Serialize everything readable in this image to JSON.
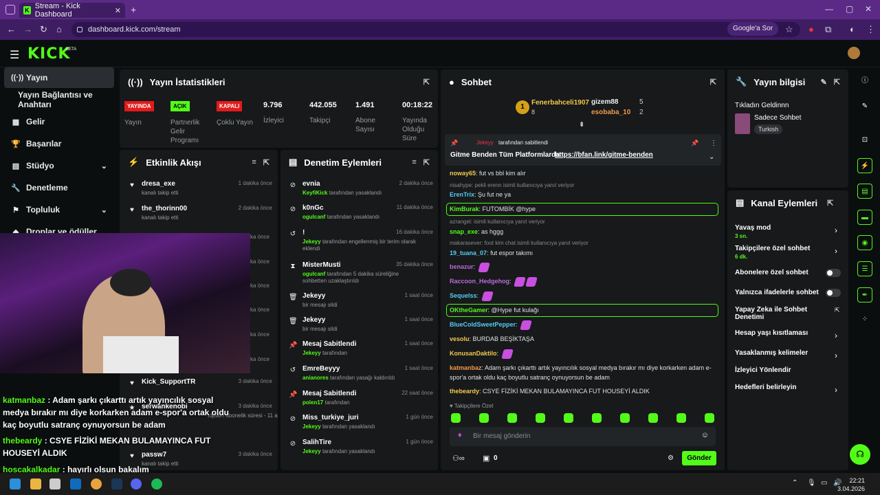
{
  "browser": {
    "tab_title": "Stream - Kick Dashboard",
    "url": "dashboard.kick.com/stream",
    "google_btn": "Google'a Sor"
  },
  "app": {
    "logo": "KICK",
    "beta": "BETA"
  },
  "sidebar": {
    "items": [
      {
        "label": "Yayın",
        "icon": "broadcast-icon"
      },
      {
        "label": "Yayın Bağlantısı ve Anahtarı",
        "icon": ""
      },
      {
        "label": "Gelir",
        "icon": "revenue-icon"
      },
      {
        "label": "Başarılar",
        "icon": "trophy-icon"
      },
      {
        "label": "Stüdyo",
        "icon": "studio-icon"
      },
      {
        "label": "Denetleme",
        "icon": "wrench-icon"
      },
      {
        "label": "Topluluk",
        "icon": "community-icon"
      },
      {
        "label": "Droplar ve ödüller",
        "icon": "drops-icon"
      }
    ]
  },
  "stats": {
    "title": "Yayın İstatistikleri",
    "cells": [
      {
        "badge": "YAYINDA",
        "label": "Yayın"
      },
      {
        "badge": "AÇIK",
        "label": "Partnerlik Gelir Programı"
      },
      {
        "badge": "KAPALI",
        "label": "Çoklu Yayın"
      },
      {
        "value": "9.796",
        "label": "İzleyici"
      },
      {
        "value": "442.055",
        "label": "Takipçi"
      },
      {
        "value": "1.491",
        "label": "Abone Sayısı"
      },
      {
        "value": "00:18:22",
        "label": "Yayında Olduğu Süre"
      }
    ]
  },
  "activity": {
    "title": "Etkinlik Akışı",
    "items": [
      {
        "name": "dresa_exe",
        "sub": "kanalı takip etti",
        "time": "1 dakika önce"
      },
      {
        "name": "the_thorinn00",
        "sub": "kanalı takip etti",
        "time": "2 dakika önce"
      },
      {
        "name": "Kick_SupportTR",
        "sub": "",
        "time": "3 dakika önce"
      },
      {
        "name": "serwankenobi",
        "sub": "toplam abonelik süresi - 11 ay!",
        "time": "3 dakika önce"
      },
      {
        "name": "passw7",
        "sub": "kanalı takip etti",
        "time": "3 dakika önce"
      }
    ],
    "hidden_times": [
      "1 dakika önce",
      "1 dakika önce",
      "1 dakika önce",
      "1 dakika önce",
      "2 dakika önce",
      "2 dakika önce"
    ]
  },
  "moderation": {
    "title": "Denetim Eylemleri",
    "items": [
      {
        "name": "evnia",
        "actor": "KeyfiKick",
        "sub": "tarafından yasaklandı",
        "time": "2 dakika önce",
        "icon": "ban-icon"
      },
      {
        "name": "k0nGc",
        "actor": "ogulcanf",
        "sub": "tarafından yasaklandı",
        "time": "11 dakika önce",
        "icon": "ban-icon"
      },
      {
        "name": "!",
        "actor": "Jekeyy",
        "sub": "tarafından engellenmiş bir terim olarak eklendi",
        "time": "16 dakika önce",
        "icon": "undo-icon"
      },
      {
        "name": "MisterMusti",
        "actor": "ogulcanf",
        "sub": "tarafından 5 dakika süreliğine sohbetten uzaklaştırıldı",
        "time": "35 dakika önce",
        "icon": "hourglass-icon"
      },
      {
        "name": "Jekeyy",
        "actor": "",
        "sub": "bir mesajı sildi",
        "time": "1 saat önce",
        "icon": "trash-icon"
      },
      {
        "name": "Jekeyy",
        "actor": "",
        "sub": "bir mesajı sildi",
        "time": "1 saat önce",
        "icon": "trash-icon"
      },
      {
        "name": "Mesaj Sabitlendi",
        "actor": "Jekeyy",
        "sub": "tarafından",
        "time": "1 saat önce",
        "icon": "pin-icon"
      },
      {
        "name": "EmreBeyyy",
        "actor": "anianores",
        "sub": "tarafından yasağı kaldırıldı",
        "time": "1 saat önce",
        "icon": "undo-icon"
      },
      {
        "name": "Mesaj Sabitlendi",
        "actor": "polen17",
        "sub": "tarafından",
        "time": "22 saat önce",
        "icon": "pin-icon"
      },
      {
        "name": "Miss_turkiye_juri",
        "actor": "Jekeyy",
        "sub": "tarafından yasaklandı",
        "time": "1 gün önce",
        "icon": "ban-icon"
      },
      {
        "name": "SalihTire",
        "actor": "Jekeyy",
        "sub": "tarafından yasaklandı",
        "time": "1 gün önce",
        "icon": "ban-icon"
      }
    ]
  },
  "chat": {
    "title": "Sohbet",
    "leaders": [
      {
        "rank": "1",
        "name": "Fenerbahceli1907",
        "count": "8"
      },
      {
        "name": "gizem88",
        "count": "5"
      },
      {
        "name": "esobaba_10",
        "count": "2"
      }
    ],
    "pinned": {
      "by": "Jekeyy",
      "by_suffix": "tarafından sabitlendi",
      "text": "Gitme Benden Tüm Platformlarda:",
      "link": "https://bfan.link/gitme-benden"
    },
    "messages": [
      {
        "user": "noway65",
        "text": "fut vs bbl kim alır",
        "color": "#f2c94c"
      },
      {
        "reply": "nisahype: pekli erenn isimli kullanıcıya yanıt veriyor"
      },
      {
        "user": "ErenTrix",
        "text": "Şu fut ne ya",
        "color": "#56ccf2"
      },
      {
        "user": "KimBurak",
        "text": "FUTOMBİK @hype",
        "color": "#53fc18",
        "hl": true
      },
      {
        "reply": "azrangel: isimli kullanıcıya yanıt veriyor"
      },
      {
        "user": "snap_exe",
        "text": "as hggg",
        "color": "#53fc18"
      },
      {
        "reply": "makarasever: foot kim chat isimli kullanıcıya yanıt veriyor"
      },
      {
        "user": "19_tuana_07",
        "text": "fut espor takımı",
        "color": "#56ccf2"
      },
      {
        "user": "benazur",
        "text": "",
        "color": "#bb6bd9"
      },
      {
        "user": "Raccoon_Hedgehog",
        "text": "",
        "color": "#bb6bd9"
      },
      {
        "user": "Sequelss",
        "text": "",
        "color": "#56ccf2"
      },
      {
        "user": "OKtheGamer",
        "text": "@Hype fut kulağı",
        "color": "#53fc18",
        "hl": true
      },
      {
        "user": "BlueColdSweetPepper",
        "text": "",
        "color": "#56ccf2"
      },
      {
        "user": "vesolu",
        "text": "BURDAB BEŞİKTAŞA",
        "color": "#f2c94c"
      },
      {
        "user": "KonusanDaktilo",
        "text": "",
        "color": "#f2c94c"
      },
      {
        "user": "katmanbaz",
        "text": "Adam şarkı çıkarttı artık yayıncılık sosyal medya bırakır mı diye korkarken adam e-spor'a ortak oldu kaç boyutlu satranç oynuyorsun be adam",
        "color": "#f2994a"
      },
      {
        "user": "thebeardy",
        "text": "CSYE FİZİKİ MEKAN BULAMAYINCA FUT HOUSEYİ ALDIK",
        "color": "#f2c94c"
      }
    ],
    "followers_only": "Takipçilere Özel",
    "input_placeholder": "Bir mesaj gönderin",
    "count": "0",
    "send": "Gönder"
  },
  "stream_info": {
    "title": "Yayın bilgisi",
    "stream_title": "Tıkladın Geldinnn",
    "category": "Sadece Sohbet",
    "tag": "Turkish"
  },
  "channel_actions": {
    "title": "Kanal Eylemleri",
    "items": [
      {
        "label": "Yavaş mod",
        "sub": "3 sn.",
        "ctrl": "chevron"
      },
      {
        "label": "Takipçilere özel sohbet",
        "sub": "6 dk.",
        "ctrl": "chevron"
      },
      {
        "label": "Abonelere özel sohbet",
        "ctrl": "toggle"
      },
      {
        "label": "Yalnızca ifadelerle sohbet",
        "ctrl": "toggle"
      },
      {
        "label": "Yapay Zeka ile Sohbet Denetimi",
        "ctrl": "external"
      },
      {
        "label": "Hesap yaşı kısıtlaması",
        "ctrl": "chevron"
      },
      {
        "label": "Yasaklanmış kelimeler",
        "ctrl": "chevron"
      },
      {
        "label": "İzleyici Yönlendir",
        "ctrl": ""
      },
      {
        "label": "Hedefleri belirleyin",
        "ctrl": "chevron"
      }
    ]
  },
  "overlay_chat": [
    {
      "user": "katmanbaz",
      "text": "Adam şarkı çıkarttı artık yayıncılık sosyal medya bırakır mı diye korkarken adam e-spor'a ortak oldu kaç boyutlu satranç oynuyorsun be adam"
    },
    {
      "user": "thebeardy",
      "text": "CSYE FİZİKİ MEKAN BULAMAYINCA FUT HOUSEYİ ALDIK"
    },
    {
      "user": "hoscakalkadar",
      "text": "hayırlı olsun bakalım"
    }
  ],
  "taskbar": {
    "time": "22:21",
    "date": "3.04.2026"
  },
  "colors": {
    "accent": "#53fc18",
    "panel": "#17191b",
    "bg": "#0b0e0f",
    "tab_bar": "#5b2a86"
  }
}
